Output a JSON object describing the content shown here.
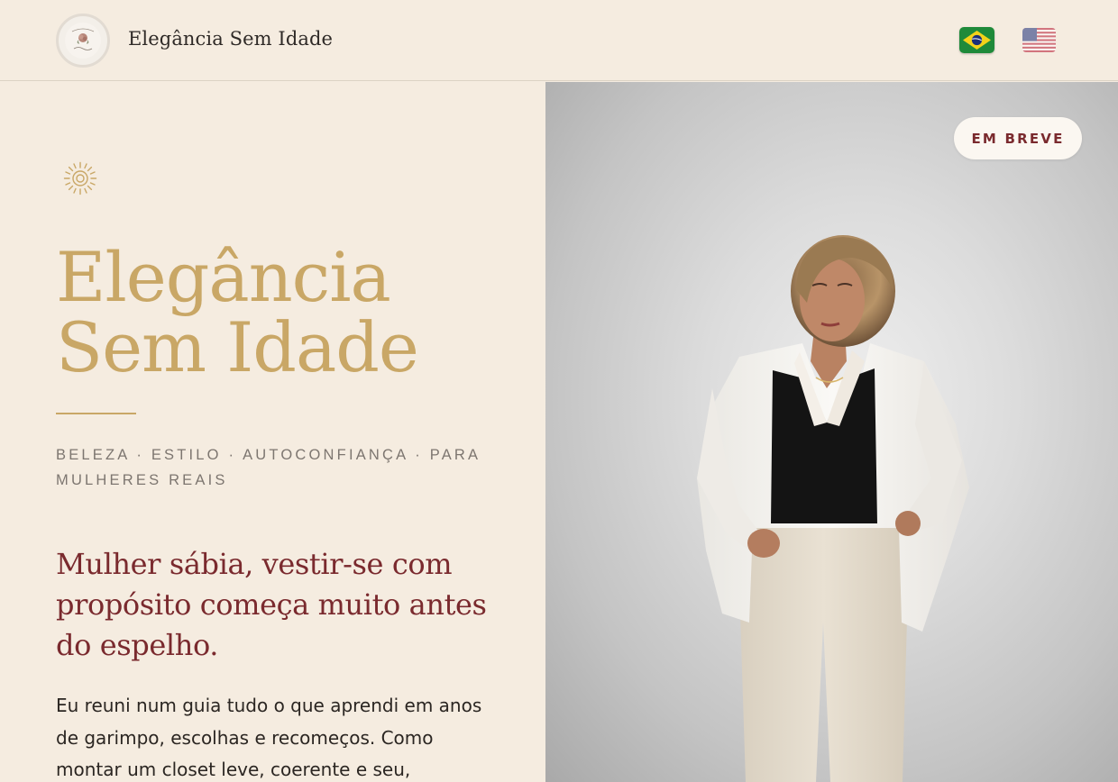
{
  "header": {
    "site_title": "Elegância Sem Idade",
    "logo_icon": "brand-logo-rose-icon",
    "languages": [
      {
        "code": "pt-BR",
        "icon": "brazil-flag-icon",
        "active": true
      },
      {
        "code": "en-US",
        "icon": "usa-flag-icon",
        "active": false
      }
    ]
  },
  "hero": {
    "decoration_icon": "sun-icon",
    "title_line1": "Elegância",
    "title_line2": "Sem Idade",
    "tagline": "Beleza · Estilo · Autoconfiança · Para Mulheres Reais",
    "quote": "Mulher sábia, vestir-se com propósito começa muito antes do espelho.",
    "body": "Eu reuni num guia tudo o que aprendi em anos de garimpo, escolhas e recomeços. Como montar um closet leve, coerente e seu,"
  },
  "photo": {
    "badge": "EM BREVE"
  },
  "colors": {
    "background": "#f5ece0",
    "gold": "#c9a766",
    "burgundy": "#7a2a2e",
    "text": "#2b2622"
  }
}
